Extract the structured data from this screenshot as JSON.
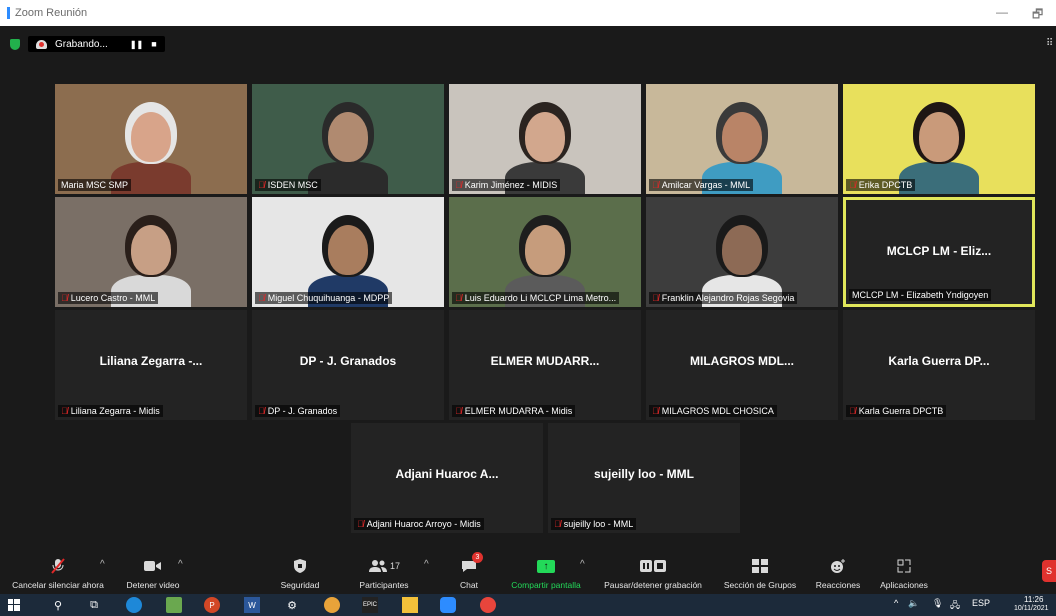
{
  "window": {
    "title": "Zoom Reunión",
    "minimize": "—",
    "restore": "🗗"
  },
  "recording": {
    "label": "Grabando...",
    "pause": "❚❚",
    "stop": "■"
  },
  "tiles": [
    {
      "big": "",
      "name": "Maria MSC SMP",
      "muted": false,
      "video": true,
      "bg": "#8c6d4f",
      "skin": "#d8a48a",
      "hair": "#e5e5e5",
      "shirt": "#7a3b2e"
    },
    {
      "big": "",
      "name": "ISDEN MSC",
      "muted": true,
      "video": true,
      "bg": "#3f5c4a",
      "skin": "#b08a70",
      "hair": "#2a2a2a",
      "shirt": "#2b2b2b"
    },
    {
      "big": "",
      "name": "Karim Jiménez - MIDIS",
      "muted": true,
      "video": true,
      "bg": "#c9c4bd",
      "skin": "#d2a78d",
      "hair": "#2b2420",
      "shirt": "#3a3a3a"
    },
    {
      "big": "",
      "name": "Amilcar Vargas - MML",
      "muted": true,
      "video": true,
      "bg": "#c8b89a",
      "skin": "#b98467",
      "hair": "#3a3a3a",
      "shirt": "#3f9cc2"
    },
    {
      "big": "",
      "name": "Erika DPCTB",
      "muted": true,
      "video": true,
      "bg": "#e8e05c",
      "skin": "#c99a7a",
      "hair": "#1e1614",
      "shirt": "#3b6e7a"
    },
    {
      "big": "",
      "name": "Lucero Castro - MML",
      "muted": true,
      "video": true,
      "bg": "#7a6f66",
      "skin": "#c79f85",
      "hair": "#2a1f1a",
      "shirt": "#d9d9d9"
    },
    {
      "big": "",
      "name": "Miguel Chuquihuanga - MDPP",
      "muted": true,
      "video": true,
      "bg": "#e6e6e6",
      "skin": "#a97d5e",
      "hair": "#1a1a1a",
      "shirt": "#203a66"
    },
    {
      "big": "",
      "name": "Luis Eduardo Li MCLCP Lima Metro...",
      "muted": true,
      "video": true,
      "bg": "#5b6e4b",
      "skin": "#c69c7c",
      "hair": "#1e1e1e",
      "shirt": "#5b5b5b"
    },
    {
      "big": "",
      "name": "Franklin Alejandro Rojas Segovia",
      "muted": true,
      "video": true,
      "bg": "#3d3d3d",
      "skin": "#8d6a55",
      "hair": "#1a1a1a",
      "shirt": "#e6e6e6"
    },
    {
      "big": "MCLCP LM - Eliz...",
      "name": "MCLCP LM - Elizabeth Yndigoyen",
      "muted": false,
      "video": false,
      "active": true
    },
    {
      "big": "Liliana Zegarra -...",
      "name": "Liliana Zegarra - Midis",
      "muted": true,
      "video": false
    },
    {
      "big": "DP - J. Granados",
      "name": "DP - J. Granados",
      "muted": true,
      "video": false
    },
    {
      "big": "ELMER  MUDARR...",
      "name": "ELMER MUDARRA - Midis",
      "muted": true,
      "video": false
    },
    {
      "big": "MILAGROS  MDL...",
      "name": "MILAGROS MDL CHOSICA",
      "muted": true,
      "video": false
    },
    {
      "big": "Karla Guerra DP...",
      "name": "Karla Guerra DPCTB",
      "muted": true,
      "video": false
    },
    {
      "big": "Adjani Huaroc A...",
      "name": "Adjani Huaroc Arroyo - Midis",
      "muted": true,
      "video": false
    },
    {
      "big": "sujeilly loo - MML",
      "name": "sujeilly loo - MML",
      "muted": true,
      "video": false
    }
  ],
  "toolbar": {
    "unmute": "Cancelar silenciar ahora",
    "stop_video": "Detener video",
    "security": "Seguridad",
    "participants": "Participantes",
    "participants_count": "17",
    "chat": "Chat",
    "chat_badge": "3",
    "share": "Compartir pantalla",
    "pause_rec": "Pausar/detener grabación",
    "breakout": "Sección de Grupos",
    "reactions": "Reacciones",
    "apps": "Aplicaciones",
    "end": "S"
  },
  "taskbar": {
    "lang": "ESP",
    "time": "11:26",
    "date": "10/11/2021"
  },
  "colors": {
    "accent": "#2d8cff",
    "share_green": "#23d959",
    "active_border": "#e0e65a",
    "red": "#e0322e"
  }
}
